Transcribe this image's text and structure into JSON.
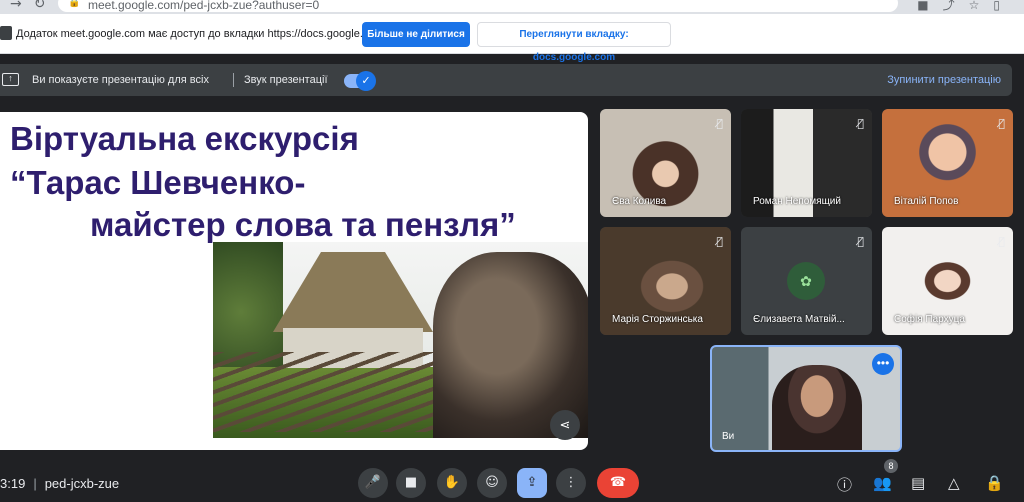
{
  "browser": {
    "url": "meet.google.com/ped-jcxb-zue?authuser=0"
  },
  "share_bar": {
    "message": "Додаток meet.google.com має доступ до вкладки https://docs.google.com",
    "stop_sharing": "Більше не ділитися",
    "view_tab": "Переглянути вкладку: docs.google.com"
  },
  "presenting_bar": {
    "status": "Ви показуєте презентацію для всіх",
    "sound_label": "Звук презентації",
    "sound_on": true,
    "stop_presentation": "Зупинити презентацію"
  },
  "slide": {
    "line1": "Віртуальна екскурсія",
    "line2": "“Тарас Шевченко-",
    "line3": "майстер слова та пензля”"
  },
  "participants": [
    {
      "name": "Єва Колива"
    },
    {
      "name": "Роман Непомящий"
    },
    {
      "name": "Віталій Попов"
    },
    {
      "name": "Марія Сторжинська"
    },
    {
      "name": "Єлизавета Матвій..."
    },
    {
      "name": "Софія Пархуца"
    }
  ],
  "self": {
    "name": "Ви"
  },
  "bottom": {
    "time": "3:19",
    "code": "ped-jcxb-zue",
    "participant_count": "8"
  },
  "colors": {
    "accent": "#1a73e8",
    "end_call": "#ea4335",
    "slide_title": "#2e1e6e"
  }
}
